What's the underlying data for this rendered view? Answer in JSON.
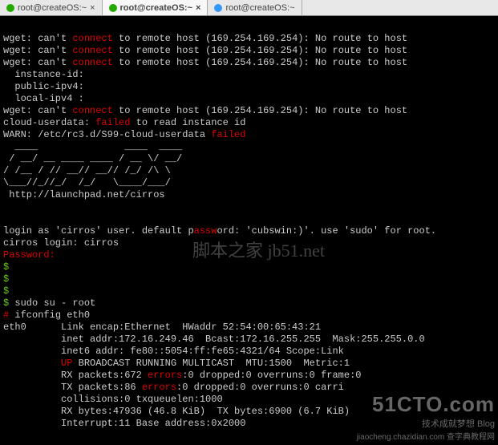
{
  "tabs": [
    {
      "icon": "g",
      "label": "root@createOS:~",
      "close": "×"
    },
    {
      "icon": "g",
      "label": "root@createOS:~",
      "close": "×"
    },
    {
      "icon": "b",
      "label": "root@createOS:~",
      "close": ""
    }
  ],
  "activeTab": 1,
  "term": {
    "l0a": "wget: can't ",
    "l0b": "connect",
    "l0c": " to remote host (169.254.169.254): No route to host",
    "l1a": "wget: can't ",
    "l1b": "connect",
    "l1c": " to remote host (169.254.169.254): No route to host",
    "l2a": "wget: can't ",
    "l2b": "connect",
    "l2c": " to remote host (169.254.169.254): No route to host",
    "l3": "  instance-id:",
    "l4": "  public-ipv4:",
    "l5": "  local-ipv4 :",
    "l6a": "wget: can't ",
    "l6b": "connect",
    "l6c": " to remote host (169.254.169.254): No route to host",
    "l7a": "cloud-userdata: ",
    "l7b": "failed",
    "l7c": " to read instance id",
    "l8a": "WARN: /etc/rc3.d/S99-cloud-userdata ",
    "l8b": "failed",
    "a0": "  ____               ____  ____",
    "a1": " / __/ __ ____ ____ / __ \\/ __/",
    "a2": "/ /__ / // __// __// /_/ /\\ \\ ",
    "a3": "\\___//_//_/  /_/   \\____/___/ ",
    "a4": " http://launchpad.net/cirros",
    "blank": "",
    "login1a": "login as 'cirros' user. default p",
    "login1b": "assw",
    "login1c": "ord: 'cubswin:)'. use 'sudo' for root.",
    "login2": "cirros login: cirros",
    "pw": "Password:",
    "p1": "$",
    "p2": "$",
    "p3": "$",
    "p4a": "$",
    "p4b": " sudo su - root",
    "p5a": "#",
    "p5b": " ifconfig eth0",
    "o0": "eth0      Link encap:Ethernet  HWaddr 52:54:00:65:43:21",
    "o1": "          inet addr:172.16.249.46  Bcast:172.16.255.255  Mask:255.255.0.0",
    "o2": "          inet6 addr: fe80::5054:ff:fe65:4321/64 Scope:Link",
    "o3a": "          ",
    "o3b": "UP",
    "o3c": " BROADCAST RUNNING MULTICAST  MTU:1500  Metric:1",
    "o4a": "          RX packets:672 ",
    "o4b": "errors",
    "o4c": ":0 dropped:0 overruns:0 frame:0",
    "o5a": "          TX packets:86 ",
    "o5b": "errors",
    "o5c": ":0 dropped:0 overruns:0 carri",
    "o6": "          collisions:0 txqueuelen:1000",
    "o7": "          RX bytes:47936 (46.8 KiB)  TX bytes:6900 (6.7 KiB)",
    "o8": "          Interrupt:11 Base address:0x2000"
  },
  "wm": {
    "center": "脚本之家 jb51.net",
    "brand": "51CTO.com",
    "sub": "技术成就梦想  Blog",
    "url": "jiaocheng.chazidian.com 查字典教程网"
  }
}
